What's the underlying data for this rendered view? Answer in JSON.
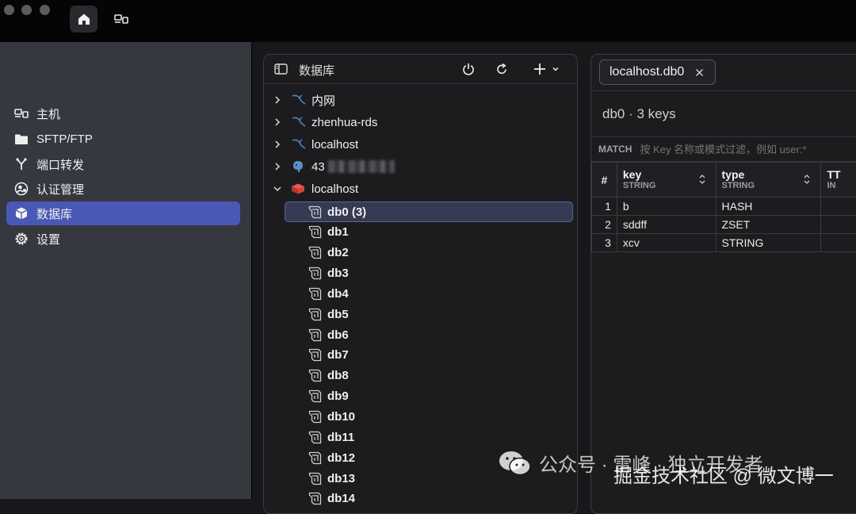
{
  "titlebar": {
    "buttons": [
      {
        "name": "home-button",
        "icon": "home-icon",
        "active": true
      },
      {
        "name": "hosts-button",
        "icon": "hosts-icon",
        "active": false
      }
    ]
  },
  "sidebar": {
    "items": [
      {
        "label": "主机",
        "icon": "host-icon",
        "active": false
      },
      {
        "label": "SFTP/FTP",
        "icon": "folder-icon",
        "active": false
      },
      {
        "label": "端口转发",
        "icon": "fork-icon",
        "active": false
      },
      {
        "label": "认证管理",
        "icon": "key-user-icon",
        "active": false
      },
      {
        "label": "数据库",
        "icon": "cube-icon",
        "active": true
      },
      {
        "label": "设置",
        "icon": "gear-icon",
        "active": false
      }
    ]
  },
  "db_panel": {
    "title": "数据库",
    "connections": [
      {
        "label": "内网",
        "type": "mysql",
        "expanded": false
      },
      {
        "label": "zhenhua-rds",
        "type": "mysql",
        "expanded": false
      },
      {
        "label": "localhost",
        "type": "mysql",
        "expanded": false
      },
      {
        "label": "43",
        "type": "postgres",
        "expanded": false,
        "blurred": true
      },
      {
        "label": "localhost",
        "type": "redis",
        "expanded": true
      }
    ],
    "databases": [
      "db0 (3)",
      "db1",
      "db2",
      "db3",
      "db4",
      "db5",
      "db6",
      "db7",
      "db8",
      "db9",
      "db10",
      "db11",
      "db12",
      "db13",
      "db14"
    ],
    "selected_database": "db0 (3)"
  },
  "right_panel": {
    "tab_label": "localhost.db0",
    "summary": "db0 · 3 keys",
    "filter": {
      "label": "MATCH",
      "placeholder": "按 Key 名称或模式过滤，例如 user:*"
    },
    "table": {
      "columns": [
        {
          "name": "#"
        },
        {
          "name": "key",
          "type": "STRING"
        },
        {
          "name": "type",
          "type": "STRING"
        },
        {
          "name": "TT",
          "type": "IN"
        }
      ],
      "rows": [
        {
          "index": "1",
          "key": "b",
          "type": "HASH",
          "ttl": ""
        },
        {
          "index": "2",
          "key": "sddff",
          "type": "ZSET",
          "ttl": ""
        },
        {
          "index": "3",
          "key": "xcv",
          "type": "STRING",
          "ttl": ""
        }
      ]
    }
  },
  "watermark": {
    "line1": "公众号 · 雷峰 · 独立开发者",
    "line2": "掘金技术社区 @ 微文博一"
  },
  "colors": {
    "accent": "#4a58b5",
    "sidebar_bg": "#363840",
    "panel_bg": "#1c1c1f",
    "redis_red": "#d9443a",
    "mysql_blue": "#4a86c8",
    "postgres_blue": "#5e8fc4"
  }
}
